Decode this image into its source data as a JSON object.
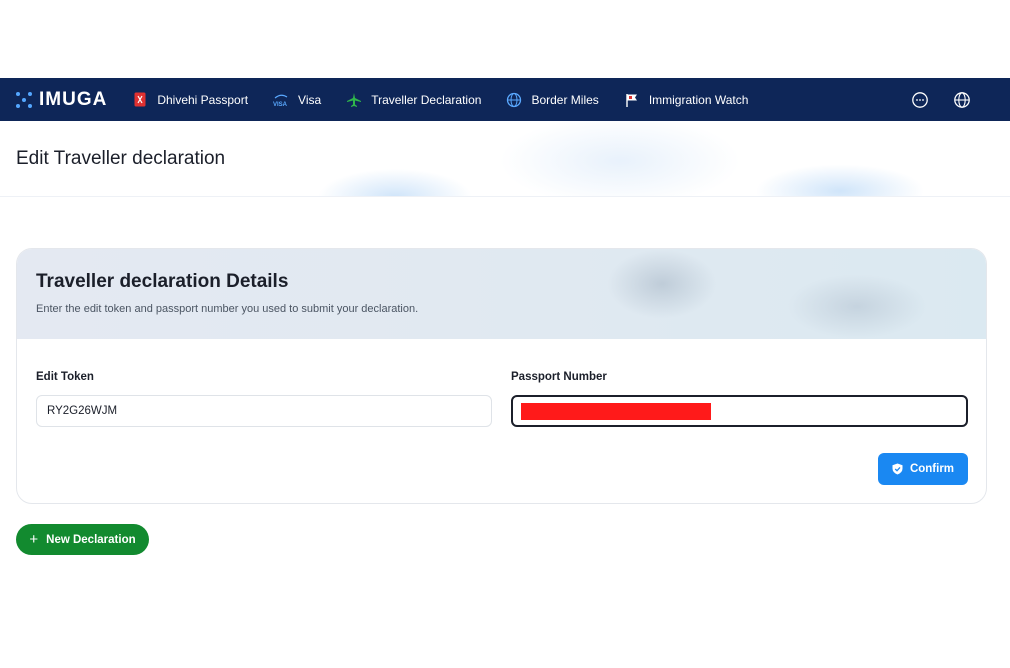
{
  "brand": {
    "name": "IMUGA"
  },
  "nav": {
    "items": [
      {
        "label": "Dhivehi Passport",
        "icon": "passport-icon"
      },
      {
        "label": "Visa",
        "icon": "visa-icon"
      },
      {
        "label": "Traveller Declaration",
        "icon": "airplane-icon"
      },
      {
        "label": "Border Miles",
        "icon": "globe-icon"
      },
      {
        "label": "Immigration Watch",
        "icon": "flag-icon"
      }
    ],
    "right_icons": [
      "chat-icon",
      "language-globe-icon"
    ]
  },
  "page": {
    "title": "Edit Traveller declaration"
  },
  "card": {
    "title": "Traveller declaration Details",
    "subtitle": "Enter the edit token and passport number you used to submit your declaration.",
    "fields": {
      "edit_token": {
        "label": "Edit Token",
        "value": "RY2G26WJM"
      },
      "passport_number": {
        "label": "Passport Number",
        "value": ""
      }
    },
    "confirm_label": "Confirm"
  },
  "new_declaration_label": "New Declaration",
  "colors": {
    "navbar": "#0e2658",
    "primary": "#1a88f2",
    "success": "#128a2f",
    "redaction": "#ff1a1a"
  }
}
